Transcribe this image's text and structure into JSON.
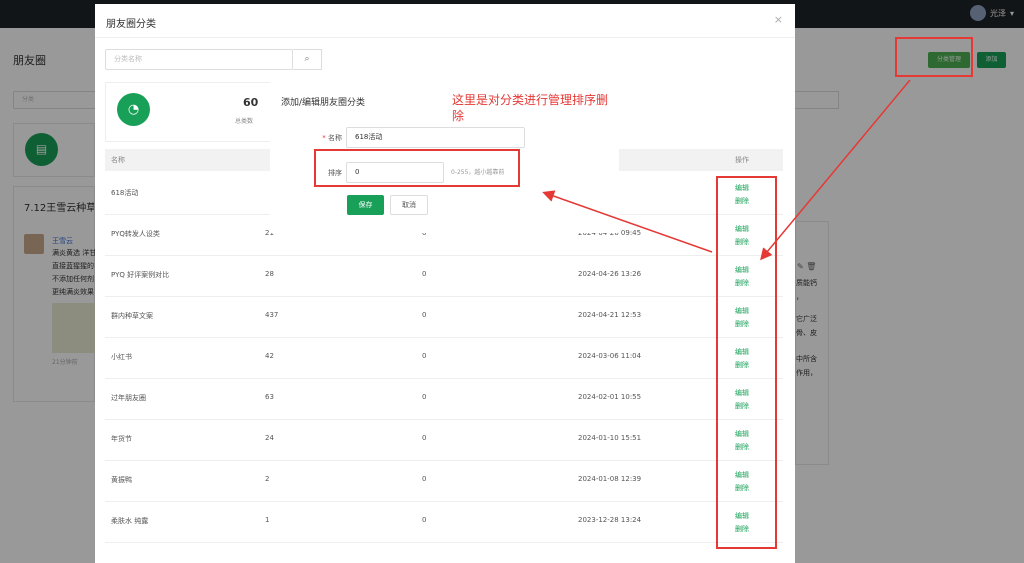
{
  "topbar": {
    "username": "光泽",
    "caret": "▾"
  },
  "page": {
    "title": "朋友圈",
    "category_button": "分类管理",
    "add_button": "添加",
    "search_placeholder": "分类",
    "post_title": "7.12王雪云种草",
    "post_author": "王雪云",
    "post_lines": [
      "满炎黄选 洋甘",
      "直接蓝猩猩的",
      "不添加任何剂",
      "更纯满炎效果"
    ],
    "post_time": "21分钟前",
    "right_lines": [
      "质能钙",
      "，",
      "它广泛",
      "骨、皮",
      "中所含",
      "作用，"
    ]
  },
  "category_dialog": {
    "title": "朋友圈分类",
    "close": "×",
    "search_placeholder": "分类名称",
    "stat_value": "60",
    "stat_label": "总类数",
    "columns": [
      "名称",
      "",
      "",
      "",
      "操作"
    ],
    "rows": [
      {
        "name": "618活动",
        "count": "",
        "views": "",
        "time": "5 09:20"
      },
      {
        "name": "PYQ转发人设类",
        "count": "21",
        "views": "0",
        "time": "2024-04-26 09:45"
      },
      {
        "name": "PYQ 好评案例对比",
        "count": "28",
        "views": "0",
        "time": "2024-04-26 13:26"
      },
      {
        "name": "群内种草文案",
        "count": "437",
        "views": "0",
        "time": "2024-04-21 12:53"
      },
      {
        "name": "小红书",
        "count": "42",
        "views": "0",
        "time": "2024-03-06 11:04"
      },
      {
        "name": "过年朋友圈",
        "count": "63",
        "views": "0",
        "time": "2024-02-01 10:55"
      },
      {
        "name": "年货节",
        "count": "24",
        "views": "0",
        "time": "2024-01-10 15:51"
      },
      {
        "name": "黄振鸭",
        "count": "2",
        "views": "0",
        "time": "2024-01-08 12:39"
      },
      {
        "name": "柔肤水 纯露",
        "count": "1",
        "views": "0",
        "time": "2023-12-28 13:24"
      }
    ],
    "edit_label": "编辑",
    "delete_label": "删除"
  },
  "edit_dialog": {
    "title": "添加/编辑朋友圈分类",
    "annotation": "这里是对分类进行管理排序删除",
    "name_required": "*",
    "name_label": "名称",
    "name_value": "618活动",
    "order_label": "排序",
    "order_value": "0",
    "order_hint": "0-255，越小越靠前",
    "save_label": "保存",
    "cancel_label": "取消"
  },
  "colors": {
    "accent": "#18a058",
    "annotation": "#e53935",
    "topbar": "#1f2329"
  },
  "icons": [
    "search-icon",
    "close-icon",
    "pie-chart-icon",
    "document-icon",
    "avatar",
    "edit-icon",
    "delete-icon",
    "chevron-down-icon"
  ]
}
